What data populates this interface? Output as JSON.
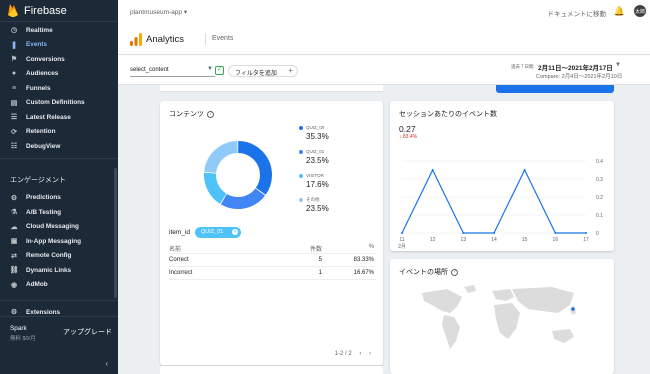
{
  "brand": {
    "name": "Firebase"
  },
  "sidebar": {
    "analytics_items": [
      {
        "label": "Realtime",
        "icon": "clock-icon"
      },
      {
        "label": "Events",
        "icon": "events-icon",
        "active": true
      },
      {
        "label": "Conversions",
        "icon": "flag-icon"
      },
      {
        "label": "Audiences",
        "icon": "audiences-icon"
      },
      {
        "label": "Funnels",
        "icon": "funnel-icon"
      },
      {
        "label": "Custom Definitions",
        "icon": "custom-def-icon"
      },
      {
        "label": "Latest Release",
        "icon": "release-icon"
      },
      {
        "label": "Retention",
        "icon": "retention-icon"
      },
      {
        "label": "DebugView",
        "icon": "debug-icon"
      }
    ],
    "engage_title": "エンゲージメント",
    "engage_items": [
      {
        "label": "Predictions",
        "icon": "predictions-icon"
      },
      {
        "label": "A/B Testing",
        "icon": "flask-icon"
      },
      {
        "label": "Cloud Messaging",
        "icon": "cloud-icon"
      },
      {
        "label": "In-App Messaging",
        "icon": "in-app-icon"
      },
      {
        "label": "Remote Config",
        "icon": "remote-config-icon"
      },
      {
        "label": "Dynamic Links",
        "icon": "link-icon"
      },
      {
        "label": "AdMob",
        "icon": "admob-icon"
      }
    ],
    "extensions": "Extensions",
    "plan_name": "Spark",
    "plan_sub": "無料 $0/月",
    "upgrade": "アップグレード"
  },
  "topbar": {
    "project": "plantmuseum-app",
    "docs": "ドキュメントに移動",
    "avatar": "太郎"
  },
  "header": {
    "title": "Analytics",
    "breadcrumb": "Events"
  },
  "filters": {
    "select_value": "select_content",
    "add_filter": "フィルタを追加",
    "date_label": "過去７日間",
    "date_range": "2月11日〜2021年2月17日",
    "compare": "Compare: 2月4日〜2021年2月10日"
  },
  "content_card": {
    "title": "コンテンツ",
    "legend": [
      {
        "name": "QUIZ_00",
        "value": "35.3%",
        "color": "#1a73e8"
      },
      {
        "name": "QUIZ_01",
        "value": "23.5%",
        "color": "#4285f4"
      },
      {
        "name": "VISITOR",
        "value": "17.6%",
        "color": "#4fc3f7"
      },
      {
        "name": "その他",
        "value": "23.5%",
        "color": "#90caf9"
      }
    ],
    "item_id_label": "item_id",
    "chip": "QUIZ_01",
    "table": {
      "headers": [
        "名前",
        "件数",
        "%"
      ],
      "rows": [
        [
          "Correct",
          "5",
          "83.33%"
        ],
        [
          "Incorrect",
          "1",
          "16.67%"
        ]
      ]
    },
    "pager": "1-2 / 2"
  },
  "session_card": {
    "title": "セッションあたりのイベント数",
    "value": "0.27",
    "delta": "↓ 83.4%"
  },
  "location_card": {
    "title": "イベントの場所"
  },
  "chart_data": [
    {
      "type": "pie",
      "title": "コンテンツ",
      "categories": [
        "QUIZ_00",
        "QUIZ_01",
        "VISITOR",
        "その他"
      ],
      "values": [
        35.3,
        23.5,
        17.6,
        23.5
      ]
    },
    {
      "type": "line",
      "title": "セッションあたりのイベント数",
      "x": [
        "11",
        "12",
        "13",
        "14",
        "15",
        "16",
        "17"
      ],
      "x_sublabel": "2月",
      "values": [
        0,
        0.35,
        0,
        0,
        0.35,
        0,
        0
      ],
      "ylim": [
        0,
        0.4
      ],
      "yticks": [
        "0",
        "0.1",
        "0.2",
        "0.3",
        "0.4"
      ],
      "y_axis_position": "right",
      "grid": true,
      "color": "#1a73e8"
    }
  ]
}
